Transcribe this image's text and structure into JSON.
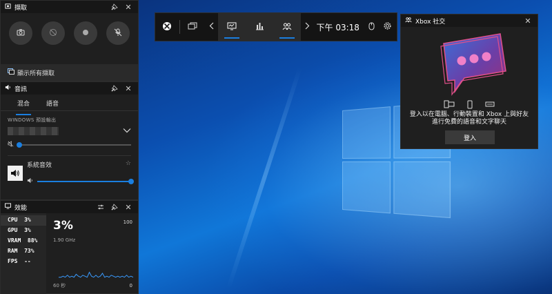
{
  "capture": {
    "title": "擷取",
    "buttons": [
      "screenshot-icon",
      "record-last-icon",
      "record-icon",
      "mic-off-icon"
    ],
    "show_all_label": "顯示所有擷取"
  },
  "audio": {
    "title": "音訊",
    "tabs": [
      "混合",
      "語音"
    ],
    "output_label": "WINDOWS 預設輸出",
    "master_volume": 0.0,
    "app_name": "系統音效",
    "app_volume": 1.0
  },
  "performance": {
    "title": "效能",
    "items": [
      {
        "label": "CPU",
        "value": "3%"
      },
      {
        "label": "GPU",
        "value": "3%"
      },
      {
        "label": "VRAM",
        "value": "88%"
      },
      {
        "label": "RAM",
        "value": "73%"
      },
      {
        "label": "FPS",
        "value": "--"
      }
    ],
    "big_value": "3%",
    "frequency": "1.90 GHz",
    "axis_max": "100",
    "axis_min": "0",
    "time_label": "60 秒",
    "graph_values": [
      3,
      3,
      4,
      3,
      5,
      3,
      4,
      3,
      6,
      4,
      3,
      5,
      4,
      3,
      8,
      4,
      3,
      5,
      3,
      4,
      7,
      3,
      4,
      3,
      5,
      4,
      3,
      4,
      3,
      4,
      3,
      5,
      3,
      4,
      3
    ]
  },
  "gamebar": {
    "time": "下午 03:18"
  },
  "social": {
    "title": "Xbox 社交",
    "description_line1": "登入以在電腦、行動裝置和 Xbox 上與好友",
    "description_line2": "進行免費的語音和文字聊天",
    "login_label": "登入"
  },
  "colors": {
    "accent": "#1a7fe0",
    "panel": "#1f1f1f",
    "bubble_pink": "#e0508a",
    "bubble_purple": "#6a3fa8"
  }
}
